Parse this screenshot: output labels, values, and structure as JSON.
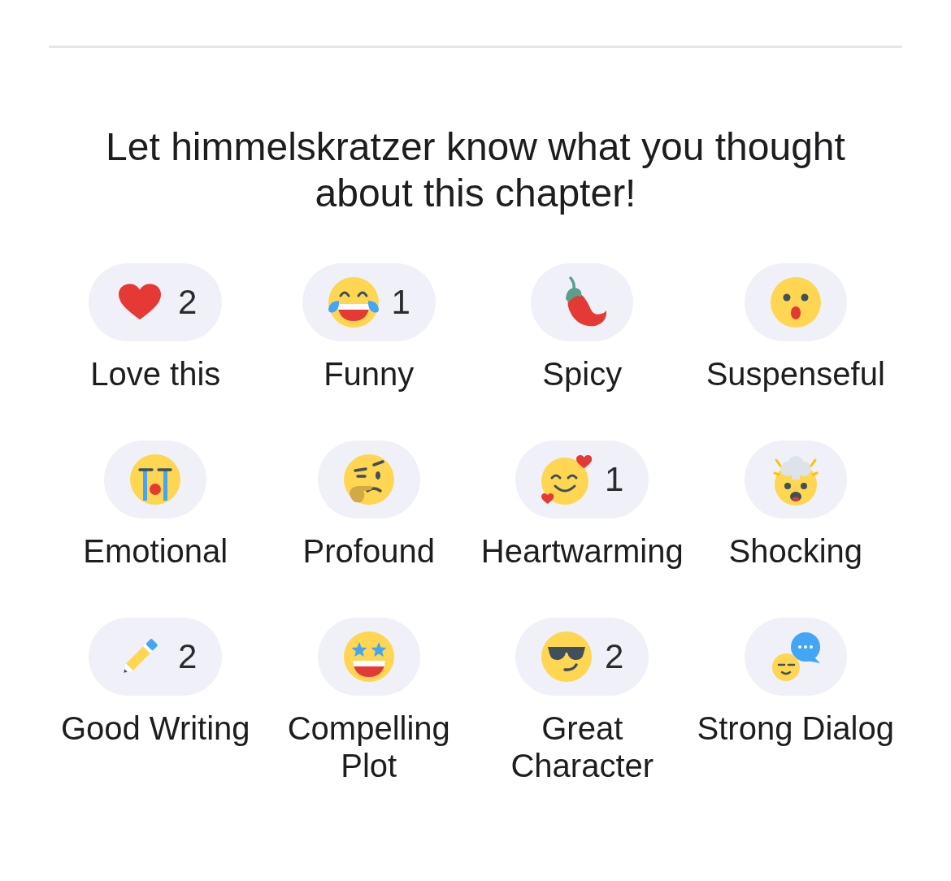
{
  "heading": "Let himmelskratzer know what you thought about this chapter!",
  "reactions": [
    {
      "label": "Love this",
      "count": "2"
    },
    {
      "label": "Funny",
      "count": "1"
    },
    {
      "label": "Spicy"
    },
    {
      "label": "Suspenseful"
    },
    {
      "label": "Emotional"
    },
    {
      "label": "Profound"
    },
    {
      "label": "Heartwarming",
      "count": "1"
    },
    {
      "label": "Shocking"
    },
    {
      "label": "Good Writing",
      "count": "2"
    },
    {
      "label": "Compelling Plot"
    },
    {
      "label": "Great Character",
      "count": "2"
    },
    {
      "label": "Strong Dialog"
    }
  ]
}
